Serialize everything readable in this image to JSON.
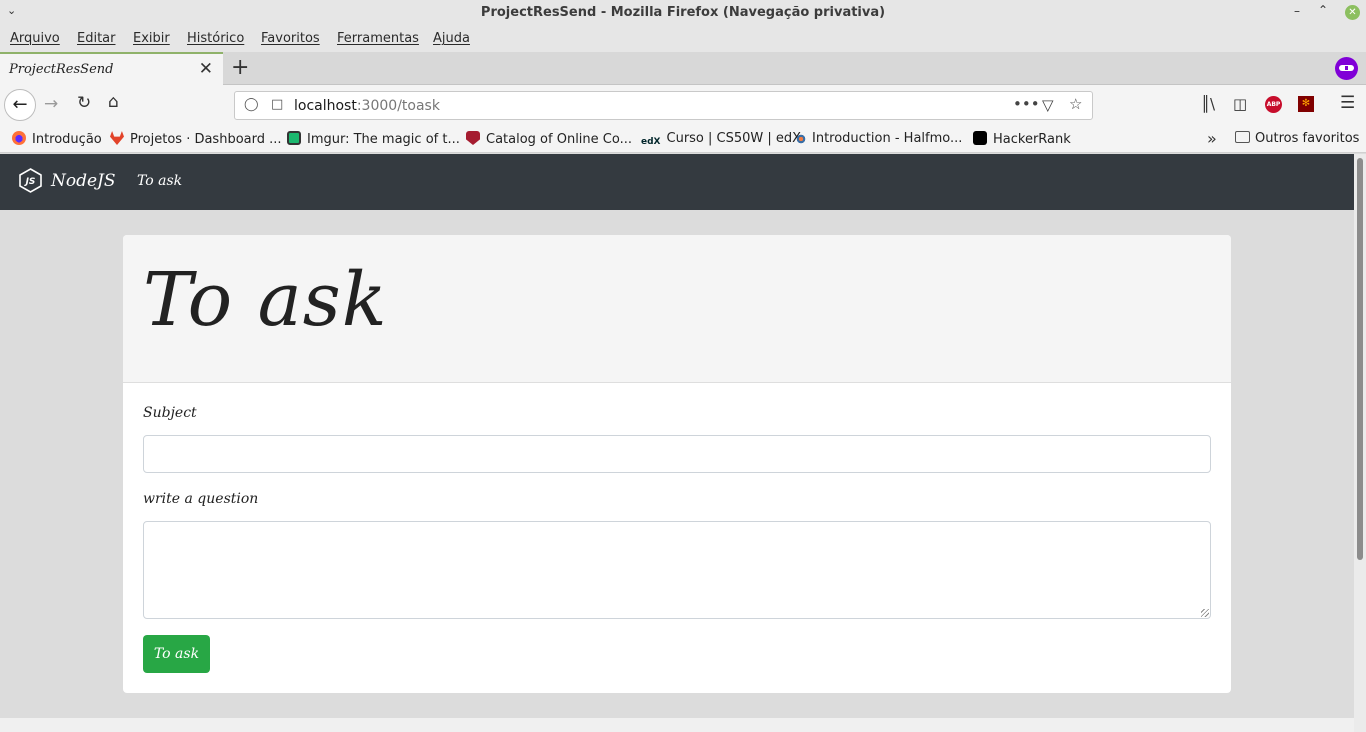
{
  "window": {
    "title": "ProjectResSend - Mozilla Firefox (Navegação privativa)"
  },
  "menu": [
    "Arquivo",
    "Editar",
    "Exibir",
    "Histórico",
    "Favoritos",
    "Ferramentas",
    "Ajuda"
  ],
  "tab": {
    "label": "ProjectResSend"
  },
  "address": {
    "host": "localhost",
    "path": ":3000/toask"
  },
  "bookmarks": [
    "Introdução",
    "Projetos · Dashboard ...",
    "Imgur: The magic of t...",
    "Catalog of Online Co...",
    "Curso | CS50W | edX",
    "Introduction - Halfmo...",
    "HackerRank"
  ],
  "bookmarks_other": "Outros favoritos",
  "bookmark_icons": {
    "edx": "edX",
    "abp": "ABP"
  },
  "app": {
    "brand": "NodeJS",
    "brand_logo": "JS",
    "nav_link": "To ask",
    "card_title": "To ask",
    "subject_label": "Subject",
    "subject_value": "",
    "question_label": "write a question",
    "question_value": "",
    "submit_label": "To ask"
  },
  "colors": {
    "navbar": "#343a40",
    "submit": "#28a745",
    "private_badge": "#8000d7"
  }
}
